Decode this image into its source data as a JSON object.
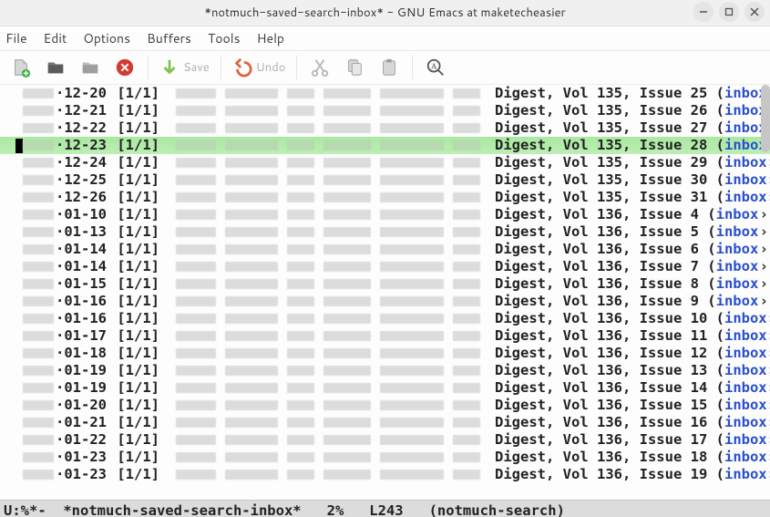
{
  "window_title": "*notmuch-saved-search-inbox* - GNU Emacs at maketecheasier",
  "menu": {
    "file": "File",
    "edit": "Edit",
    "options": "Options",
    "buffers": "Buffers",
    "tools": "Tools",
    "help": "Help"
  },
  "toolbar": {
    "save": "Save",
    "undo": "Undo"
  },
  "colors": {
    "highlight": "#a9e8a2",
    "tag": "#2a4fcf"
  },
  "modeline": {
    "left": "U:%*-  ",
    "buffer": "*notmuch-saved-search-inbox*",
    "pct": "   2%   ",
    "line": "L243",
    "mode": "   (notmuch-search)"
  },
  "selected_index": 3,
  "rows": [
    {
      "date": "12-20",
      "count": "[1/1]",
      "subject": "Digest, Vol 135, Issue 25",
      "tag": "inbox"
    },
    {
      "date": "12-21",
      "count": "[1/1]",
      "subject": "Digest, Vol 135, Issue 26",
      "tag": "inbox"
    },
    {
      "date": "12-22",
      "count": "[1/1]",
      "subject": "Digest, Vol 135, Issue 27",
      "tag": "inbox"
    },
    {
      "date": "12-23",
      "count": "[1/1]",
      "subject": "Digest, Vol 135, Issue 28",
      "tag": "inbox"
    },
    {
      "date": "12-24",
      "count": "[1/1]",
      "subject": "Digest, Vol 135, Issue 29",
      "tag": "inbox"
    },
    {
      "date": "12-25",
      "count": "[1/1]",
      "subject": "Digest, Vol 135, Issue 30",
      "tag": "inbox"
    },
    {
      "date": "12-26",
      "count": "[1/1]",
      "subject": "Digest, Vol 135, Issue 31",
      "tag": "inbox"
    },
    {
      "date": "01-10",
      "count": "[1/1]",
      "subject": "Digest, Vol 136, Issue 4",
      "tag": "inbox"
    },
    {
      "date": "01-13",
      "count": "[1/1]",
      "subject": "Digest, Vol 136, Issue 5",
      "tag": "inbox"
    },
    {
      "date": "01-14",
      "count": "[1/1]",
      "subject": "Digest, Vol 136, Issue 6",
      "tag": "inbox"
    },
    {
      "date": "01-14",
      "count": "[1/1]",
      "subject": "Digest, Vol 136, Issue 7",
      "tag": "inbox"
    },
    {
      "date": "01-15",
      "count": "[1/1]",
      "subject": "Digest, Vol 136, Issue 8",
      "tag": "inbox"
    },
    {
      "date": "01-16",
      "count": "[1/1]",
      "subject": "Digest, Vol 136, Issue 9",
      "tag": "inbox"
    },
    {
      "date": "01-16",
      "count": "[1/1]",
      "subject": "Digest, Vol 136, Issue 10",
      "tag": "inbox"
    },
    {
      "date": "01-17",
      "count": "[1/1]",
      "subject": "Digest, Vol 136, Issue 11",
      "tag": "inbox"
    },
    {
      "date": "01-18",
      "count": "[1/1]",
      "subject": "Digest, Vol 136, Issue 12",
      "tag": "inbox"
    },
    {
      "date": "01-19",
      "count": "[1/1]",
      "subject": "Digest, Vol 136, Issue 13",
      "tag": "inbox"
    },
    {
      "date": "01-19",
      "count": "[1/1]",
      "subject": "Digest, Vol 136, Issue 14",
      "tag": "inbox"
    },
    {
      "date": "01-20",
      "count": "[1/1]",
      "subject": "Digest, Vol 136, Issue 15",
      "tag": "inbox"
    },
    {
      "date": "01-21",
      "count": "[1/1]",
      "subject": "Digest, Vol 136, Issue 16",
      "tag": "inbox"
    },
    {
      "date": "01-22",
      "count": "[1/1]",
      "subject": "Digest, Vol 136, Issue 17",
      "tag": "inbox"
    },
    {
      "date": "01-23",
      "count": "[1/1]",
      "subject": "Digest, Vol 136, Issue 18",
      "tag": "inbox"
    },
    {
      "date": "01-23",
      "count": "[1/1]",
      "subject": "Digest, Vol 136, Issue 19",
      "tag": "inbox"
    }
  ]
}
